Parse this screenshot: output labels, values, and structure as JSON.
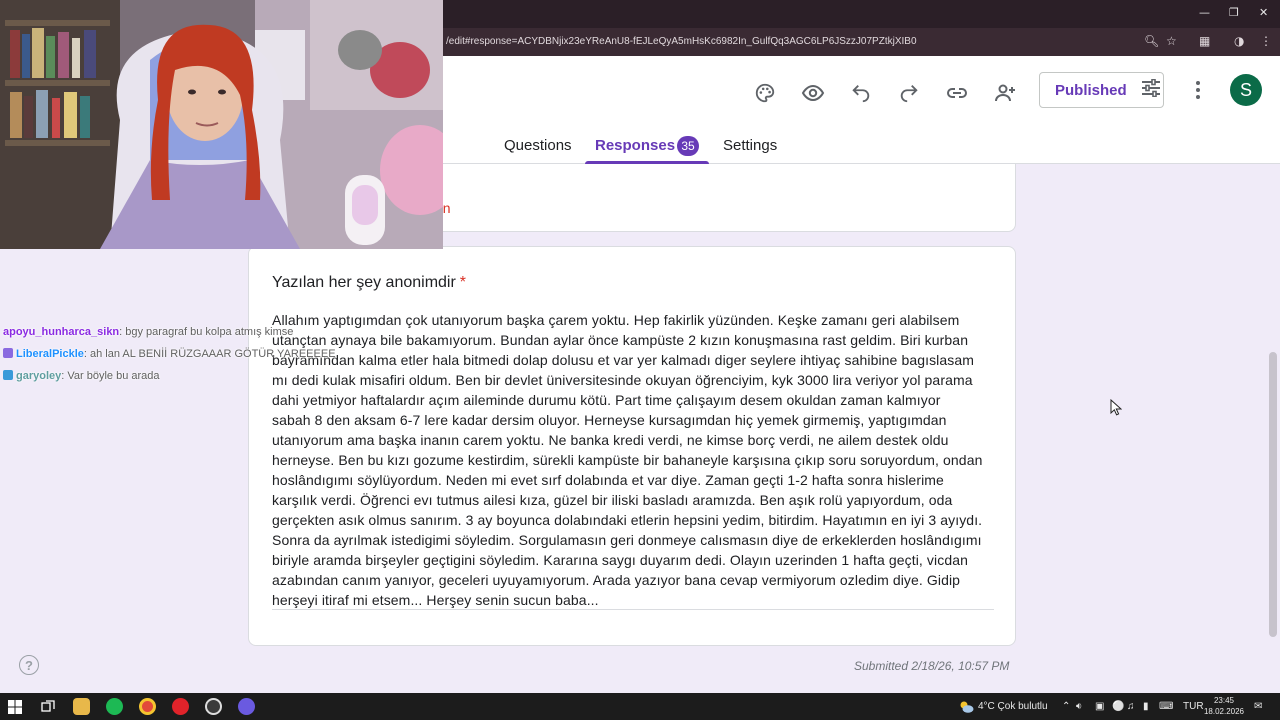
{
  "browser": {
    "url": "/edit#response=ACYDBNjix23eYReAnU8-fEJLeQyA5mHsKc6982In_GulfQq3AGC6LP6JSzzJ07PZtkjXIB0",
    "window_controls": [
      "—",
      "❐",
      "✕"
    ]
  },
  "header": {
    "tabs": [
      {
        "label": "Questions"
      },
      {
        "label": "Responses",
        "badge": "35"
      },
      {
        "label": "Settings"
      }
    ],
    "publish_label": "Published",
    "avatar_letter": "S",
    "accent_color": "#673ab7"
  },
  "response": {
    "prev_card_text": "on",
    "question_title": "Yazılan her şey anonimdir",
    "required_mark": "*",
    "answer_lines": [
      "Allahım yaptıgımdan çok utanıyorum başka çarem yoktu. Hep fakirlik yüzünden. Keşke zamanı geri alabilsem",
      "utançtan aynaya bile bakamıyorum. Bundan aylar önce kampüste 2 kızın konuşmasına rast geldim. Biri kurban",
      "bayramından kalma etler hala bitmedi dolap dolusu et var yer kalmadı diger seylere ihtiyaç sahibine bagıslasam",
      "mı dedi kulak misafiri oldum. Ben bir devlet üniversitesinde okuyan öğrenciyim, kyk 3000 lira veriyor yol parama",
      "dahi yetmiyor haftalardır açım aileminde durumu kötü. Part time çalışayım desem okuldan zaman kalmıyor",
      "sabah 8 den aksam 6-7 lere kadar dersim oluyor. Herneyse kursagımdan hiç yemek girmemiş, yaptıgımdan",
      "utanıyorum ama başka inanın carem yoktu. Ne banka kredi verdi, ne kimse borç verdi, ne ailem destek oldu",
      "herneyse. Ben bu kızı gozume kestirdim, sürekli kampüste bir bahaneyle karşısına çıkıp soru soruyordum, ondan",
      "hoslândıgımı söylüyordum. Neden mi evet sırf dolabında et var diye. Zaman geçti 1-2 hafta sonra hislerime",
      "karşılık verdi. Öğrenci evı tutmus ailesi kıza, güzel bir iliski basladı aramızda. Ben aşık rolü yapıyordum, oda",
      "gerçekten asık olmus sanırım. 3 ay boyunca dolabındaki etlerin hepsini yedim, bitirdim. Hayatımın en iyi 3 ayıydı.",
      "Sonra da ayrılmak istedigimi söyledim. Sorgulamasın geri donmeye calısmasın diye de erkeklerden hoslândıgımı",
      "biriyle aramda birşeyler geçtigini söyledim. Kararına saygı duyarım dedi. Olayın uzerinden 1 hafta geçti, vicdan",
      "azabından canım yanıyor, geceleri uyuyamıyorum. Arada yazıyor bana cevap vermiyorum ozledim diye. Gidip",
      "herşeyi itiraf mi etsem... Herşey senin sucun baba..."
    ],
    "submitted": "Submitted 2/18/26, 10:57 PM"
  },
  "chat": [
    {
      "user": "apoyu_hunharca_sikn",
      "message": ": bgy paragraf bu kolpa atmış kimse",
      "color": "#8a2be2"
    },
    {
      "user": "LiberalPickle",
      "message": ": ah lan AL BENİİ RÜZGAAAR GÖTÜR YAREEEEE",
      "color": "#1e90ff"
    },
    {
      "user": "garyoley",
      "message": ": Var böyle bu arada",
      "color": "#5f9ea0"
    }
  ],
  "taskbar": {
    "weather": "4°C  Çok bulutlu",
    "language": "TUR",
    "time": "23:45",
    "date": "18.02.2026"
  }
}
